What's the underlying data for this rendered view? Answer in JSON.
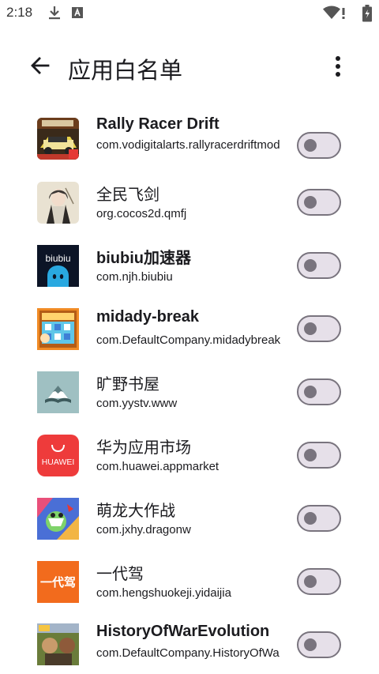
{
  "status_bar": {
    "time": "2:18",
    "icons": [
      "download-icon",
      "text-box-icon",
      "wifi-icon",
      "battery-icon"
    ]
  },
  "toolbar": {
    "back_icon": "arrow-left-icon",
    "title": "应用白名单",
    "menu_icon": "more-vertical-icon"
  },
  "colors": {
    "switch_track": "#e6e0e9",
    "switch_outline": "#79747e",
    "text": "#1b1b1f"
  },
  "apps": [
    {
      "name": "Rally Racer Drift",
      "package": "com.vodigitalarts.rallyracerdriftmod",
      "enabled": false,
      "icon": "rally-racer-icon"
    },
    {
      "name": "全民飞剑",
      "package": "org.cocos2d.qmfj",
      "enabled": false,
      "icon": "quanmin-feijian-icon"
    },
    {
      "name": "biubiu加速器",
      "package": "com.njh.biubiu",
      "enabled": false,
      "icon": "biubiu-icon"
    },
    {
      "name": "midady-break",
      "package": "com.DefaultCompany.midadybreak",
      "enabled": false,
      "icon": "midady-break-icon"
    },
    {
      "name": "旷野书屋",
      "package": "com.yystv.www",
      "enabled": false,
      "icon": "kuangye-shuwu-icon"
    },
    {
      "name": "华为应用市场",
      "package": "com.huawei.appmarket",
      "enabled": false,
      "icon": "huawei-appgallery-icon",
      "icon_text": "HUAWEI"
    },
    {
      "name": "萌龙大作战",
      "package": "com.jxhy.dragonw",
      "enabled": false,
      "icon": "menglong-icon"
    },
    {
      "name": "一代驾",
      "package": "com.hengshuokeji.yidaijia",
      "enabled": false,
      "icon": "yidaijia-icon",
      "icon_text": "一代驾"
    },
    {
      "name": "HistoryOfWarEvolution",
      "package": "com.DefaultCompany.HistoryOfWa",
      "enabled": false,
      "icon": "history-of-war-icon"
    }
  ]
}
